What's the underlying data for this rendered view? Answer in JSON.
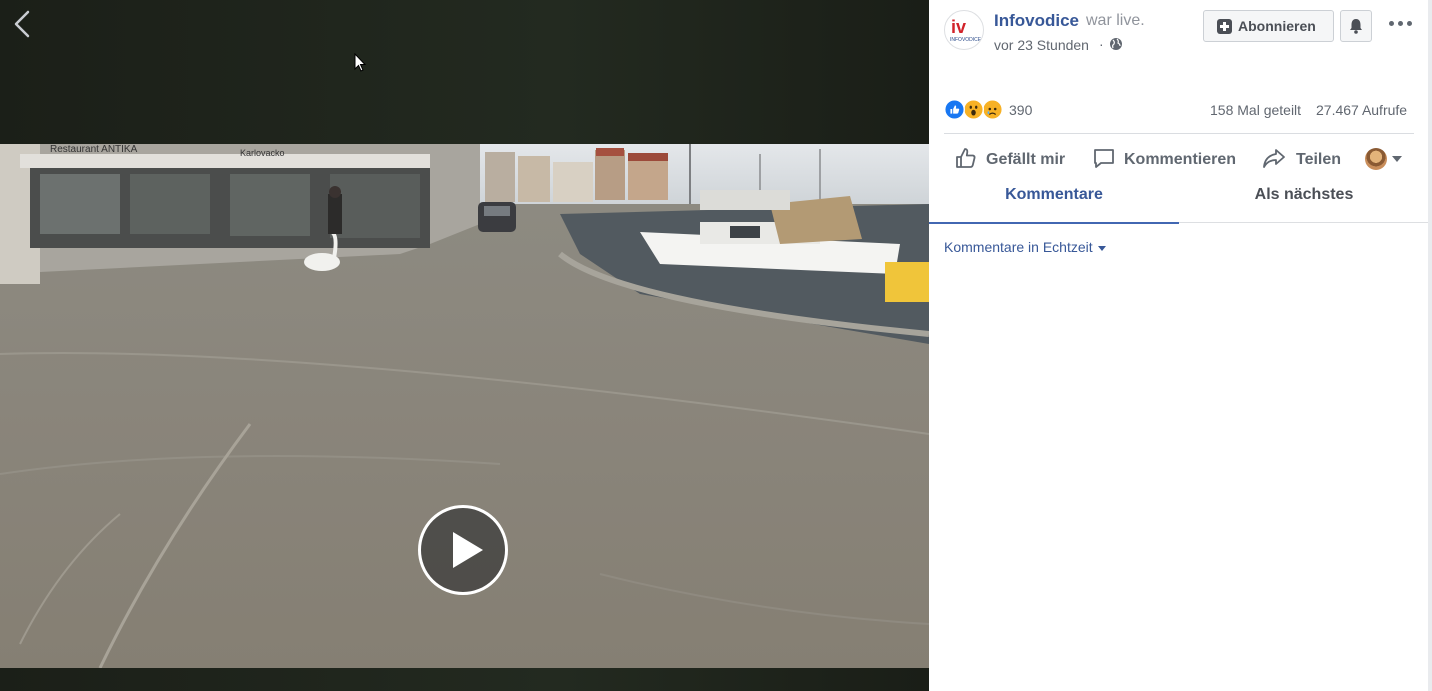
{
  "post": {
    "page_name": "Infovodice",
    "status": "war live.",
    "time": "vor 23 Stunden",
    "dot": "·",
    "avatar_text": "iv",
    "avatar_caption": "INFOVODICE"
  },
  "header_actions": {
    "subscribe_label": "Abonnieren"
  },
  "stats": {
    "reaction_count": "390",
    "shares": "158 Mal geteilt",
    "views": "27.467 Aufrufe",
    "reactions": [
      "like-icon",
      "wow-icon",
      "sad-icon"
    ]
  },
  "actions": {
    "like": "Gefällt mir",
    "comment": "Kommentieren",
    "share": "Teilen"
  },
  "tabs": {
    "comments": "Kommentare",
    "next": "Als nächstes"
  },
  "comments": {
    "filter_label": "Kommentare in Echtzeit"
  },
  "colors": {
    "link_blue": "#385898",
    "like_blue": "#1877f2",
    "reaction_yellow": "#f7b125",
    "text_gray": "#606770"
  }
}
